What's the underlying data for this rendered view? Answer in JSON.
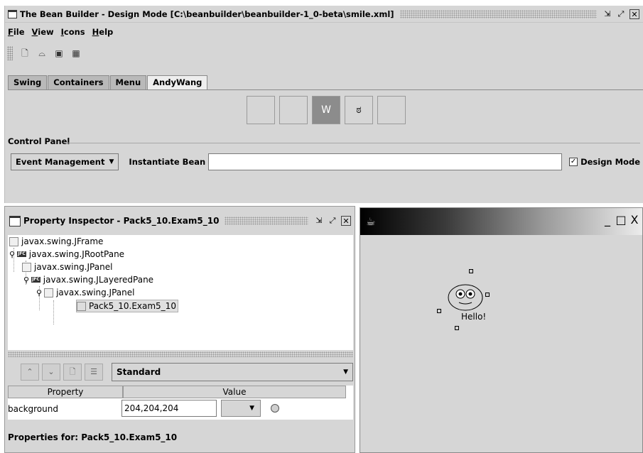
{
  "main_window": {
    "title": "The Bean Builder - Design Mode [C:\\beanbuilder\\beanbuilder-1_0-beta\\smile.xml]",
    "menu": [
      "File",
      "View",
      "Icons",
      "Help"
    ],
    "toolbar_icons": [
      "new-file-icon",
      "open-folder-icon",
      "save-icon",
      "properties-icon"
    ],
    "tabs": [
      "Swing",
      "Containers",
      "Menu",
      "AndyWang"
    ],
    "active_tab": "AndyWang",
    "palette_icons": [
      "empty-slot",
      "empty-slot",
      "w-bean-icon",
      "smiley-bean-icon",
      "empty-slot"
    ],
    "control_panel": {
      "label": "Control Panel",
      "event_management": "Event Management",
      "instantiate_bean_label": "Instantiate Bean",
      "instantiate_bean_value": "",
      "design_mode_label": "Design Mode",
      "design_mode_checked": true
    }
  },
  "property_inspector": {
    "title": "Property Inspector - Pack5_10.Exam5_10",
    "tree": {
      "n0": "javax.swing.JFrame",
      "n1": "javax.swing.JRootPane",
      "n2": "javax.swing.JPanel",
      "n3": "javax.swing.JLayeredPane",
      "n4": "javax.swing.JPanel",
      "n5": "Pack5_10.Exam5_10"
    },
    "selected_node": "Pack5_10.Exam5_10",
    "view_combo": "Standard",
    "table": {
      "header_property": "Property",
      "header_value": "Value",
      "row_property": "background",
      "row_value": "204,204,204"
    },
    "properties_for": "Properties for:  Pack5_10.Exam5_10"
  },
  "bean_window": {
    "title": "",
    "controls": {
      "minimize": "_",
      "maximize": "□",
      "close": "X"
    },
    "bean_text": "Hello!"
  }
}
